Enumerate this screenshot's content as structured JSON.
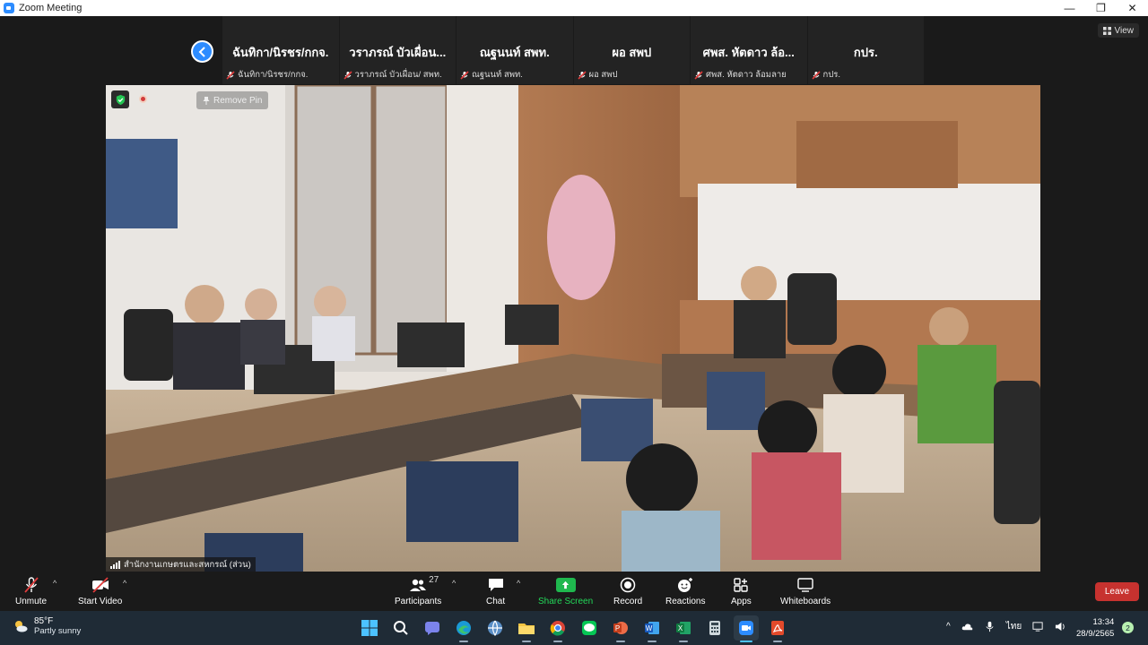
{
  "window": {
    "title": "Zoom Meeting"
  },
  "view_button": {
    "label": "View"
  },
  "participants_strip": [
    {
      "display_name": "ฉันทิกา/นิรชร/กกจ.",
      "footer_name": "ฉันทิกา/นิรชร/กกจ."
    },
    {
      "display_name": "วราภรณ์ บัวเผื่อน...",
      "footer_name": "วราภรณ์ บัวเผื่อน/ สพท."
    },
    {
      "display_name": "ณฐนนท์ สพท.",
      "footer_name": "ณฐนนท์ สพท."
    },
    {
      "display_name": "ผอ สพป",
      "footer_name": "ผอ สพป"
    },
    {
      "display_name": "ศพส. หัตดาว ล้อ...",
      "footer_name": "ศพส. หัตดาว ล้อมลาย"
    },
    {
      "display_name": "กปร.",
      "footer_name": "กปร."
    }
  ],
  "main_video": {
    "remove_pin_label": "Remove Pin",
    "label": "สำนักงานเกษตรและสหกรณ์ (ส่วน)"
  },
  "toolbar": {
    "unmute": "Unmute",
    "start_video": "Start Video",
    "participants": "Participants",
    "participants_count": "27",
    "chat": "Chat",
    "share_screen": "Share Screen",
    "record": "Record",
    "reactions": "Reactions",
    "apps": "Apps",
    "whiteboards": "Whiteboards",
    "leave": "Leave"
  },
  "taskbar": {
    "weather_temp": "85°F",
    "weather_desc": "Partly sunny",
    "language": "ไทย",
    "time": "13:34",
    "date": "28/9/2565",
    "notification_count": "2",
    "apps": [
      "windows-start-icon",
      "search-icon",
      "chat-icon",
      "edge-icon",
      "network-icon",
      "file-explorer-icon",
      "chrome-icon",
      "line-icon",
      "powerpoint-icon",
      "word-icon",
      "excel-icon",
      "calculator-icon",
      "zoom-icon",
      "acrobat-icon"
    ]
  },
  "colors": {
    "accent": "#2d8cff",
    "leave": "#c7322f",
    "share": "#1fb84e",
    "taskbar": "#1f2b36"
  }
}
